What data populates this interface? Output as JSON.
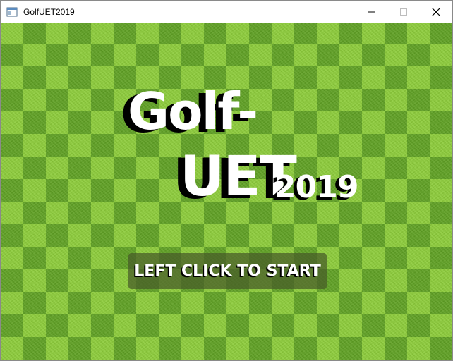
{
  "window": {
    "title": "GolfUET2019",
    "controls": {
      "minimize_icon": "minimize-icon",
      "maximize_icon": "maximize-icon",
      "close_icon": "close-icon"
    }
  },
  "logo": {
    "line1": "Golf-",
    "line2": "UET",
    "year": "2019"
  },
  "start_button": {
    "label": "LEFT CLICK TO START"
  },
  "colors": {
    "grass_light": "#8ccc3a",
    "grass_dark": "#5fa023",
    "logo_text": "#ffffff",
    "logo_shadow": "#000000"
  }
}
